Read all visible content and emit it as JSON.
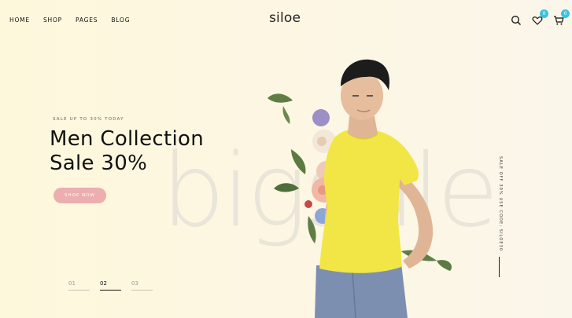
{
  "nav": {
    "items": [
      "HOME",
      "SHOP",
      "PAGES",
      "BLOG"
    ]
  },
  "logo": "siloe",
  "header": {
    "wishlist_count": "0",
    "cart_count": "0"
  },
  "hero": {
    "subtitle": "SALE UP TO 30% TODAY",
    "title_line1": "Men Collection",
    "title_line2": "Sale 30%",
    "button_label": "SHOP NOW",
    "background_text": "bigsale",
    "side_text": "SALE OFF 30% USE CODE: SILOE30"
  },
  "pager": [
    "01",
    "02",
    "03"
  ],
  "colors": {
    "accent_button": "#ecaeae",
    "badge": "#38c4df",
    "shirt": "#f1e645"
  }
}
